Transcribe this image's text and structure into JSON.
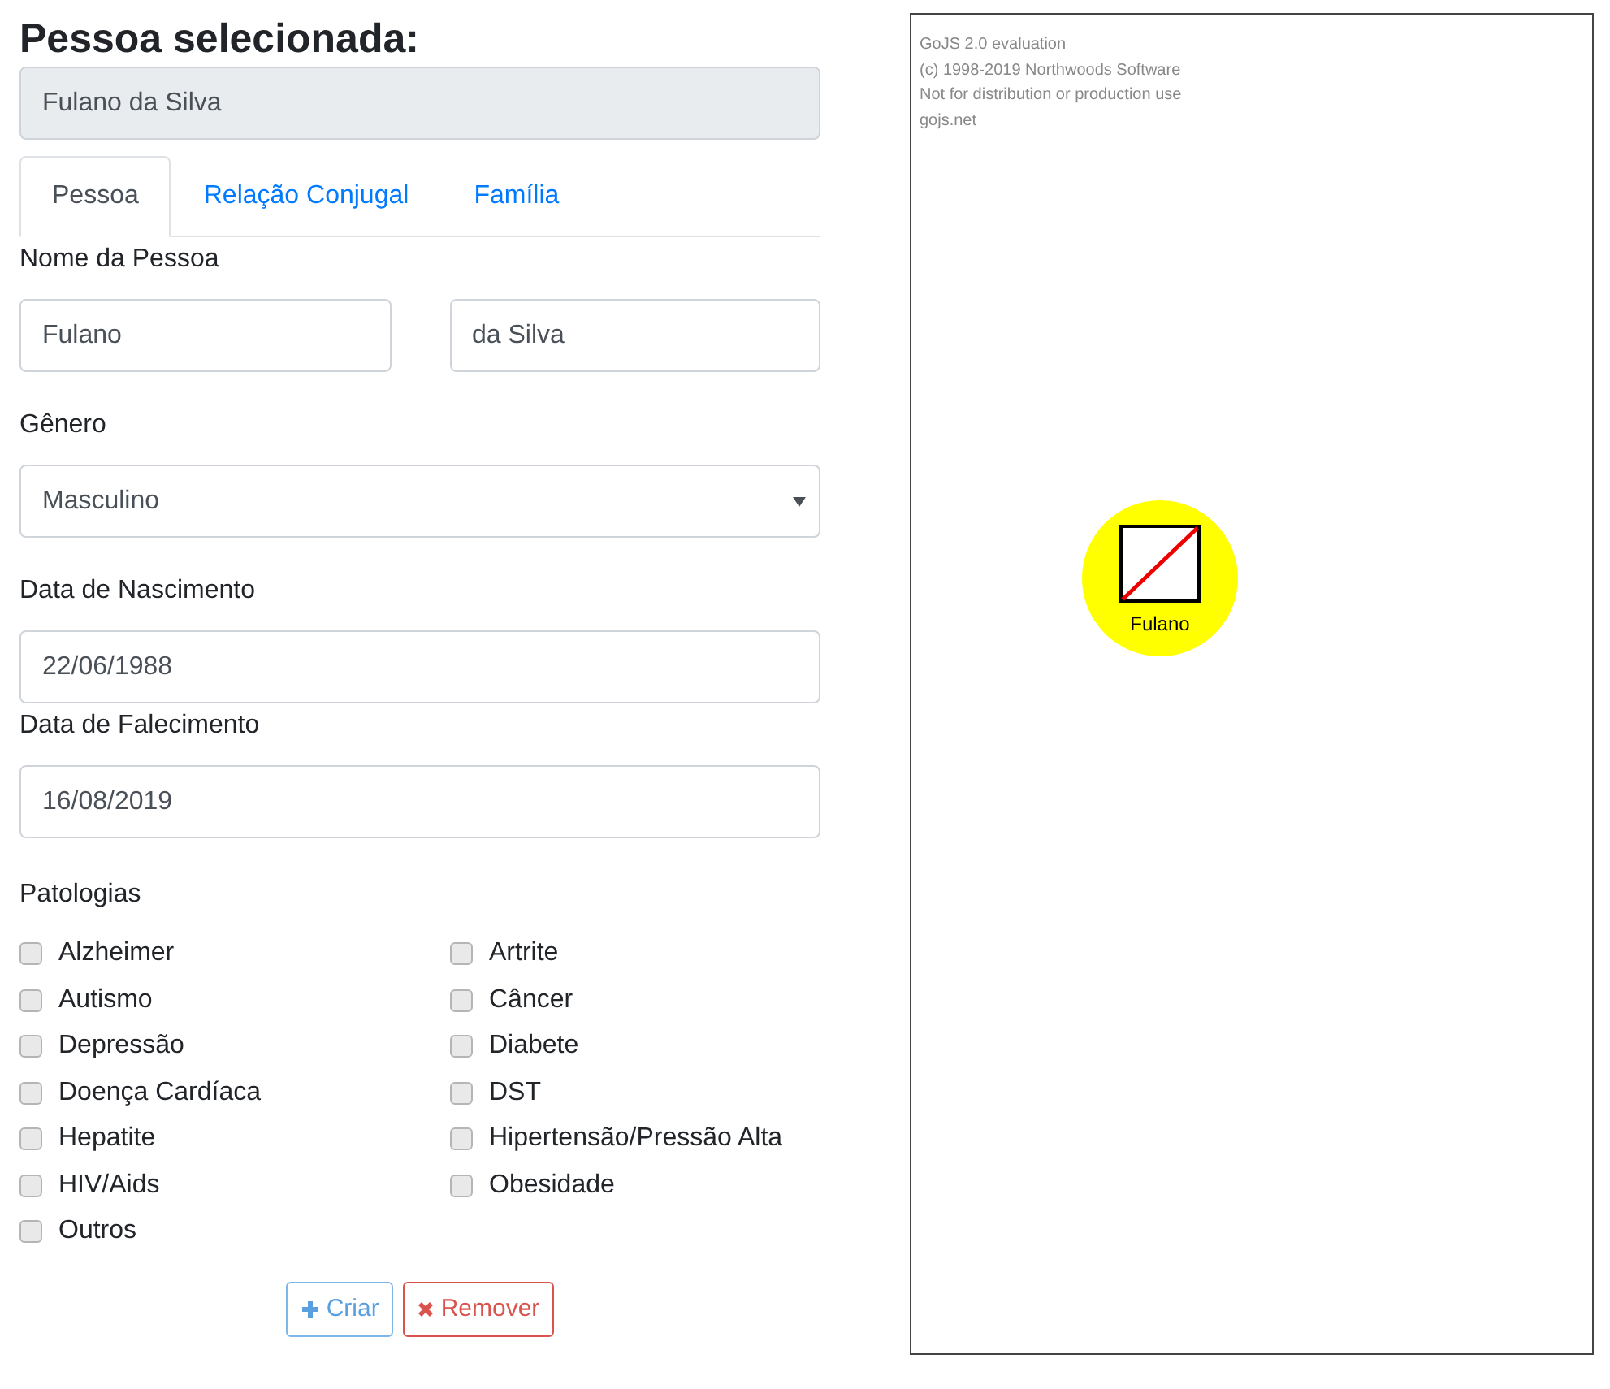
{
  "heading": "Pessoa selecionada:",
  "selected_person": {
    "value": "Fulano da Silva",
    "disabled": true
  },
  "tabs": [
    {
      "label": "Pessoa",
      "selected": true
    },
    {
      "label": "Relação Conjugal",
      "selected": false
    },
    {
      "label": "Família",
      "selected": false
    }
  ],
  "form": {
    "name_label": "Nome da Pessoa",
    "first_name": "Fulano",
    "last_name": "da Silva",
    "gender_label": "Gênero",
    "gender": "Masculino",
    "birth_label": "Data de Nascimento",
    "birth_date": "22/06/1988",
    "death_label": "Data de Falecimento",
    "death_date": "16/08/2019",
    "pathologies_label": "Patologias"
  },
  "pathologies": [
    {
      "label": "Alzheimer",
      "checked": false
    },
    {
      "label": "Artrite",
      "checked": false
    },
    {
      "label": "Autismo",
      "checked": false
    },
    {
      "label": "Câncer",
      "checked": false
    },
    {
      "label": "Depressão",
      "checked": false
    },
    {
      "label": "Diabete",
      "checked": false
    },
    {
      "label": "Doença Cardíaca",
      "checked": false
    },
    {
      "label": "DST",
      "checked": false
    },
    {
      "label": "Hepatite",
      "checked": false
    },
    {
      "label": "Hipertensão/Pressão Alta",
      "checked": false
    },
    {
      "label": "HIV/Aids",
      "checked": false
    },
    {
      "label": "Obesidade",
      "checked": false
    },
    {
      "label": "Outros",
      "checked": false
    }
  ],
  "buttons": [
    {
      "label": "Criar",
      "kind": "create"
    },
    {
      "label": "Remover",
      "kind": "remove"
    }
  ],
  "diagram": {
    "watermark": [
      "GoJS 2.0 evaluation",
      "(c) 1998-2019 Northwoods Software",
      "Not for distribution or production use",
      "gojs.net"
    ],
    "nodes": [
      {
        "label": "Fulano",
        "kind": "male",
        "deceased": true
      }
    ]
  }
}
